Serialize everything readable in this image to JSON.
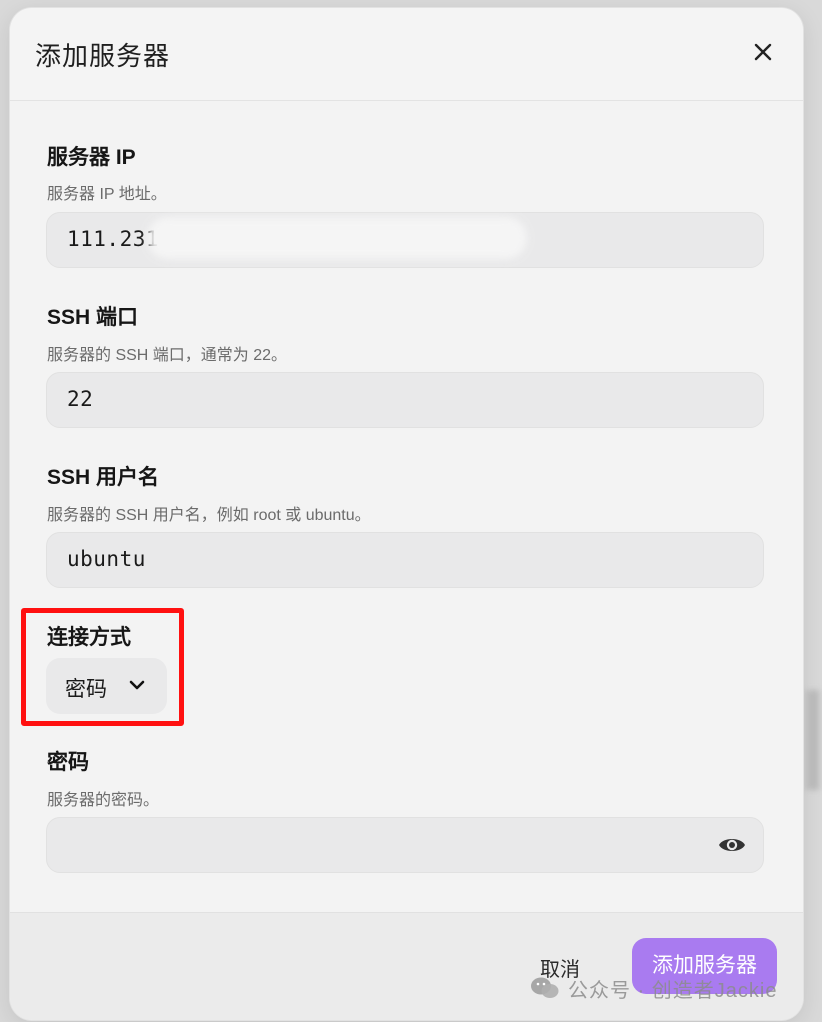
{
  "dialog": {
    "title": "添加服务器"
  },
  "fields": {
    "ip": {
      "label": "服务器 IP",
      "hint": "服务器 IP 地址。",
      "value": "111.231"
    },
    "port": {
      "label": "SSH 端口",
      "hint": "服务器的 SSH 端口，通常为 22。",
      "value": "22"
    },
    "username": {
      "label": "SSH 用户名",
      "hint": "服务器的 SSH 用户名，例如 root 或 ubuntu。",
      "value": "ubuntu"
    },
    "connection": {
      "label": "连接方式",
      "selected": "密码"
    },
    "password": {
      "label": "密码",
      "hint": "服务器的密码。",
      "value": ""
    }
  },
  "footer": {
    "cancel_label": "取消",
    "submit_label": "添加服务器"
  },
  "watermark": {
    "text": "公众号 · 创造者Jackie"
  },
  "colors": {
    "accent": "#a97bf0",
    "highlight_box": "#ff1010"
  },
  "icons": {
    "close": "close-icon",
    "dropdown": "chevron-down-icon",
    "reveal": "eye-icon",
    "watermark_logo": "wechat-icon"
  }
}
